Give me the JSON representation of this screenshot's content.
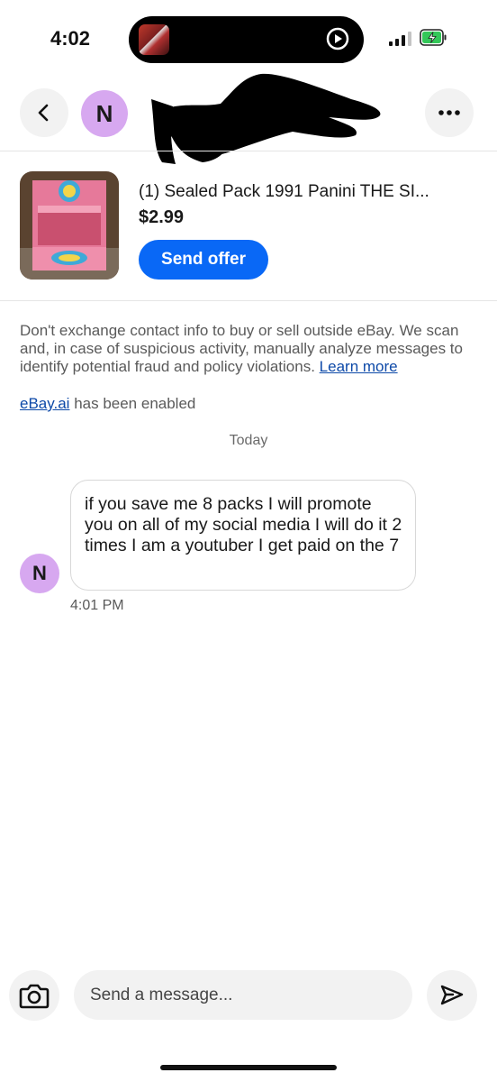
{
  "status_bar": {
    "time": "4:02"
  },
  "header": {
    "contact_initial": "N"
  },
  "listing": {
    "title": "(1) Sealed Pack 1991 Panini THE SI...",
    "price": "$2.99",
    "send_offer_label": "Send offer"
  },
  "notice": {
    "text": "Don't exchange contact info to buy or sell outside eBay. We scan and, in case of suspicious activity, manually analyze messages to identify potential fraud and policy violations.",
    "link_label": "Learn more"
  },
  "ai_notice": {
    "link_label": "eBay.ai",
    "text": "has been enabled"
  },
  "date_divider": "Today",
  "messages": [
    {
      "sender_initial": "N",
      "text": "if you save me 8 packs I will promote you on all of my social media I will do it 2 times I am a youtuber I get paid on the 7",
      "time": "4:01 PM"
    }
  ],
  "composer": {
    "placeholder": "Send a message..."
  },
  "colors": {
    "accent": "#0968f6",
    "avatar": "#d7a8f0",
    "link": "#0d49a8"
  }
}
